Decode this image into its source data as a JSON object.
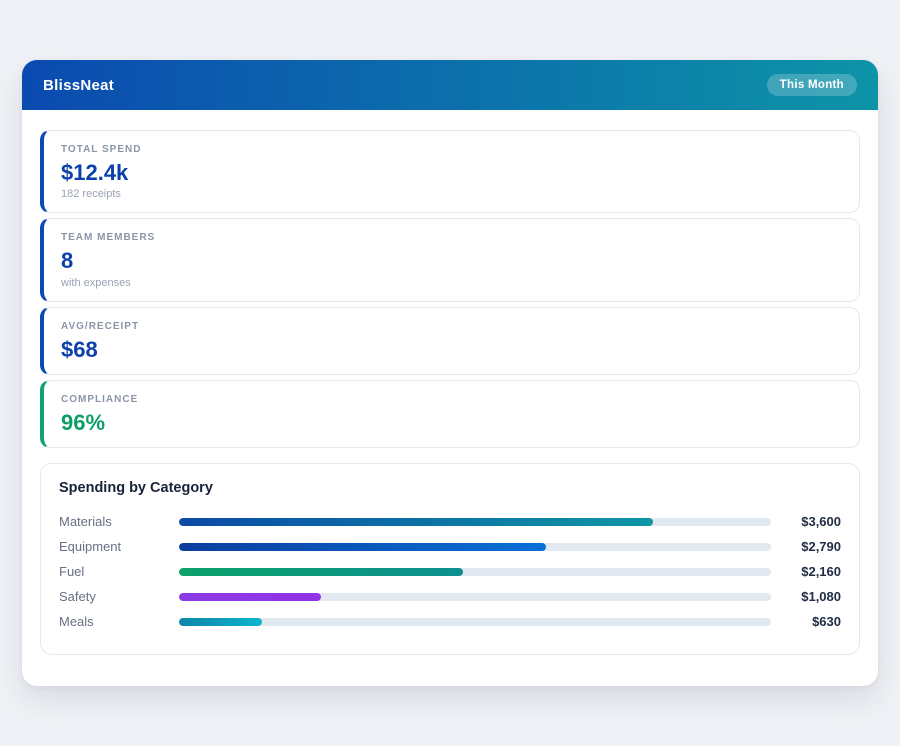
{
  "header": {
    "title": "BlissNeat",
    "badge": "This Month",
    "gradient_from": "#0b4ab0",
    "gradient_to": "#0d94a7"
  },
  "stats": [
    {
      "label": "TOTAL SPEND",
      "value": "$12.4k",
      "sub": "182 receipts",
      "accent": "#0b4ab0",
      "value_color": "#0c41ab"
    },
    {
      "label": "TEAM MEMBERS",
      "value": "8",
      "sub": "with expenses",
      "accent": "#0b4ab0",
      "value_color": "#0c41ab"
    },
    {
      "label": "AVG/RECEIPT",
      "value": "$68",
      "sub": "",
      "accent": "#0b4ab0",
      "value_color": "#0c41ab"
    },
    {
      "label": "COMPLIANCE",
      "value": "96%",
      "sub": "",
      "accent": "#10a36c",
      "value_color": "#0c9e66"
    }
  ],
  "chart_data": {
    "type": "bar",
    "orientation": "horizontal",
    "title": "Spending by Category",
    "categories": [
      "Materials",
      "Equipment",
      "Fuel",
      "Safety",
      "Meals"
    ],
    "values": [
      3600,
      2790,
      2160,
      1080,
      630
    ],
    "value_labels": [
      "$3,600",
      "$2,790",
      "$2,160",
      "$1,080",
      "$630"
    ],
    "axis_max": 4500,
    "fill_percents": [
      80,
      62,
      48,
      24,
      14
    ],
    "track_color": "#e2e8f0",
    "bar_gradients": [
      {
        "from": "#0b4aa6",
        "to": "#0d97a4"
      },
      {
        "from": "#0b3f9e",
        "to": "#0a70d6"
      },
      {
        "from": "#0ca26a",
        "to": "#0d8f8f"
      },
      {
        "from": "#8b3ae4",
        "to": "#9233e6"
      },
      {
        "from": "#0c86a6",
        "to": "#0fb4cf"
      }
    ]
  }
}
